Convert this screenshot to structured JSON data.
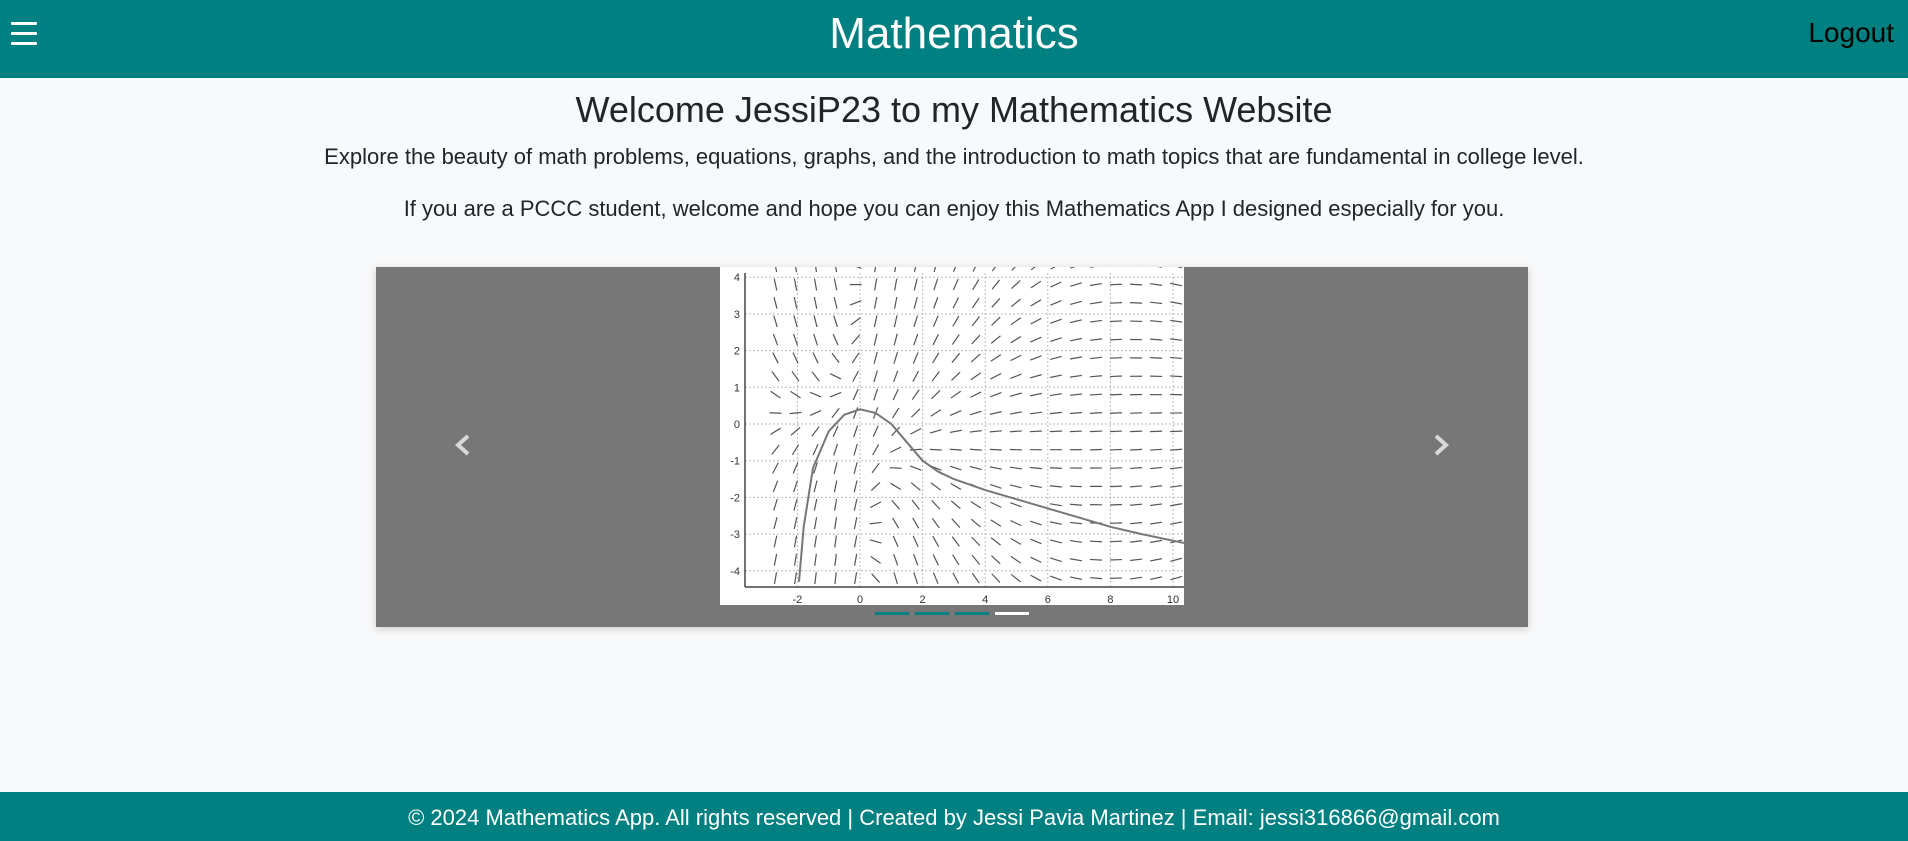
{
  "header": {
    "menu_icon": "hamburger-menu-icon",
    "title": "Mathematics",
    "logout_label": "Logout",
    "bg_color": "#008080"
  },
  "main": {
    "welcome": "Welcome JessiP23 to my Mathematics Website",
    "intro_1": "Explore the beauty of math problems, equations, graphs, and the introduction to math topics that are fundamental in college level.",
    "intro_2": "If you are a PCCC student, welcome and hope you can enjoy this Mathematics App I designed especially for you."
  },
  "carousel": {
    "prev_icon": "chevron-left-icon",
    "next_icon": "chevron-right-icon",
    "slide_count": 4,
    "active_index": 3,
    "slide": {
      "description_icon": "slope-field-graph",
      "x_ticks": [
        "-2",
        "0",
        "2",
        "4",
        "6",
        "8",
        "10"
      ],
      "y_ticks": [
        "4",
        "3",
        "2",
        "1",
        "0",
        "-1",
        "-2",
        "-3",
        "-4"
      ]
    }
  },
  "footer": {
    "text": "© 2024 Mathematics App. All rights reserved | Created by Jessi Pavia Martinez | Email: jessi316866@gmail.com"
  }
}
